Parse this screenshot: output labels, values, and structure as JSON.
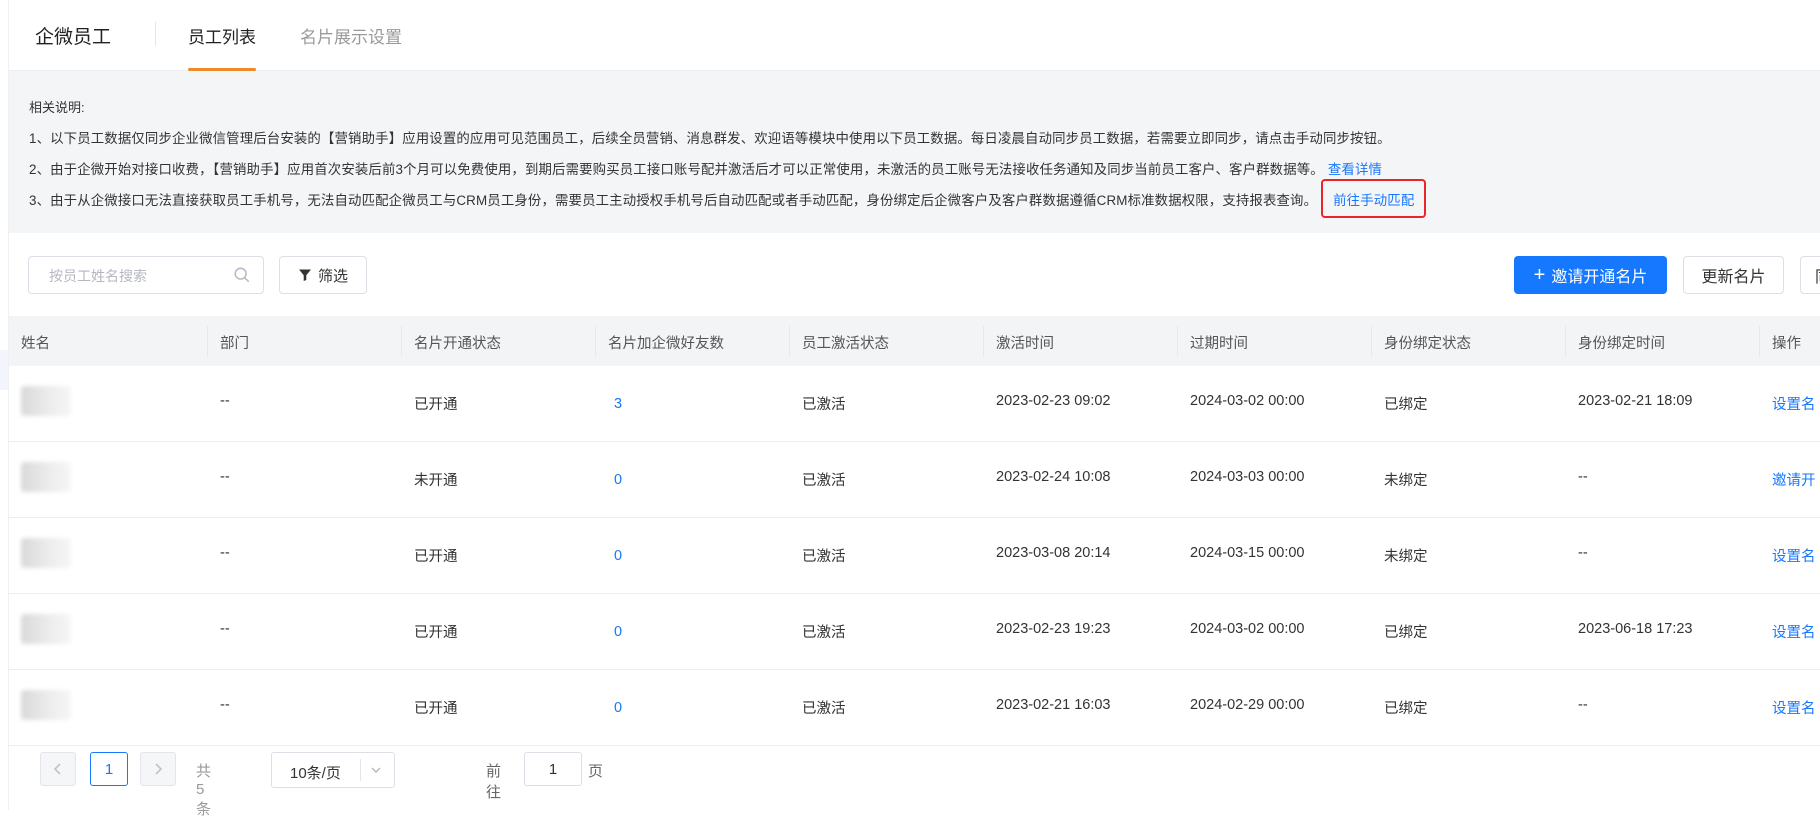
{
  "header": {
    "brand": "企微员工",
    "tabs": [
      {
        "label": "员工列表",
        "active": true
      },
      {
        "label": "名片展示设置",
        "active": false
      }
    ]
  },
  "notice": {
    "title": "相关说明:",
    "line1": "1、以下员工数据仅同步企业微信管理后台安装的【营销助手】应用设置的应用可见范围员工，后续全员营销、消息群发、欢迎语等模块中使用以下员工数据。每日凌晨自动同步员工数据，若需要立即同步，请点击手动同步按钮。",
    "line2": "2、由于企微开始对接口收费，【营销助手】应用首次安装后前3个月可以免费使用，到期后需要购买员工接口账号配并激活后才可以正常使用，未激活的员工账号无法接收任务通知及同步当前员工客户、客户群数据等。",
    "line2_link": "查看详情",
    "line3": "3、由于从企微接口无法直接获取员工手机号，无法自动匹配企微员工与CRM员工身份，需要员工主动授权手机号后自动匹配或者手动匹配，身份绑定后企微客户及客户群数据遵循CRM标准数据权限，支持报表查询。",
    "line3_link": "前往手动匹配"
  },
  "toolbar": {
    "search_placeholder": "按员工姓名搜索",
    "filter_label": "筛选",
    "invite_label": "邀请开通名片",
    "update_label": "更新名片",
    "cut_label": "同"
  },
  "table": {
    "columns": [
      "姓名",
      "部门",
      "名片开通状态",
      "名片加企微好友数",
      "员工激活状态",
      "激活时间",
      "过期时间",
      "身份绑定状态",
      "身份绑定时间",
      "操作"
    ],
    "rows": [
      {
        "dept": "--",
        "card_status": "已开通",
        "friends": "3",
        "active_status": "已激活",
        "activated": "2023-02-23 09:02",
        "expires": "2024-03-02 00:00",
        "bind_status": "已绑定",
        "bind_time": "2023-02-21 18:09",
        "action": "设置名"
      },
      {
        "dept": "--",
        "card_status": "未开通",
        "friends": "0",
        "active_status": "已激活",
        "activated": "2023-02-24 10:08",
        "expires": "2024-03-03 00:00",
        "bind_status": "未绑定",
        "bind_time": "--",
        "action": "邀请开"
      },
      {
        "dept": "--",
        "card_status": "已开通",
        "friends": "0",
        "active_status": "已激活",
        "activated": "2023-03-08 20:14",
        "expires": "2024-03-15 00:00",
        "bind_status": "未绑定",
        "bind_time": "--",
        "action": "设置名"
      },
      {
        "dept": "--",
        "card_status": "已开通",
        "friends": "0",
        "active_status": "已激活",
        "activated": "2023-02-23 19:23",
        "expires": "2024-03-02 00:00",
        "bind_status": "已绑定",
        "bind_time": "2023-06-18 17:23",
        "action": "设置名"
      },
      {
        "dept": "--",
        "card_status": "已开通",
        "friends": "0",
        "active_status": "已激活",
        "activated": "2023-02-21 16:03",
        "expires": "2024-02-29 00:00",
        "bind_status": "已绑定",
        "bind_time": "--",
        "action": "设置名"
      }
    ]
  },
  "pagination": {
    "current_page": "1",
    "total": "共 5 条",
    "page_size": "10条/页",
    "goto_label": "前往",
    "goto_value": "1",
    "page_unit": "页"
  },
  "colors": {
    "accent": "#1677ff",
    "tab_underline": "#f08a24",
    "highlight_box": "#e8262a"
  }
}
